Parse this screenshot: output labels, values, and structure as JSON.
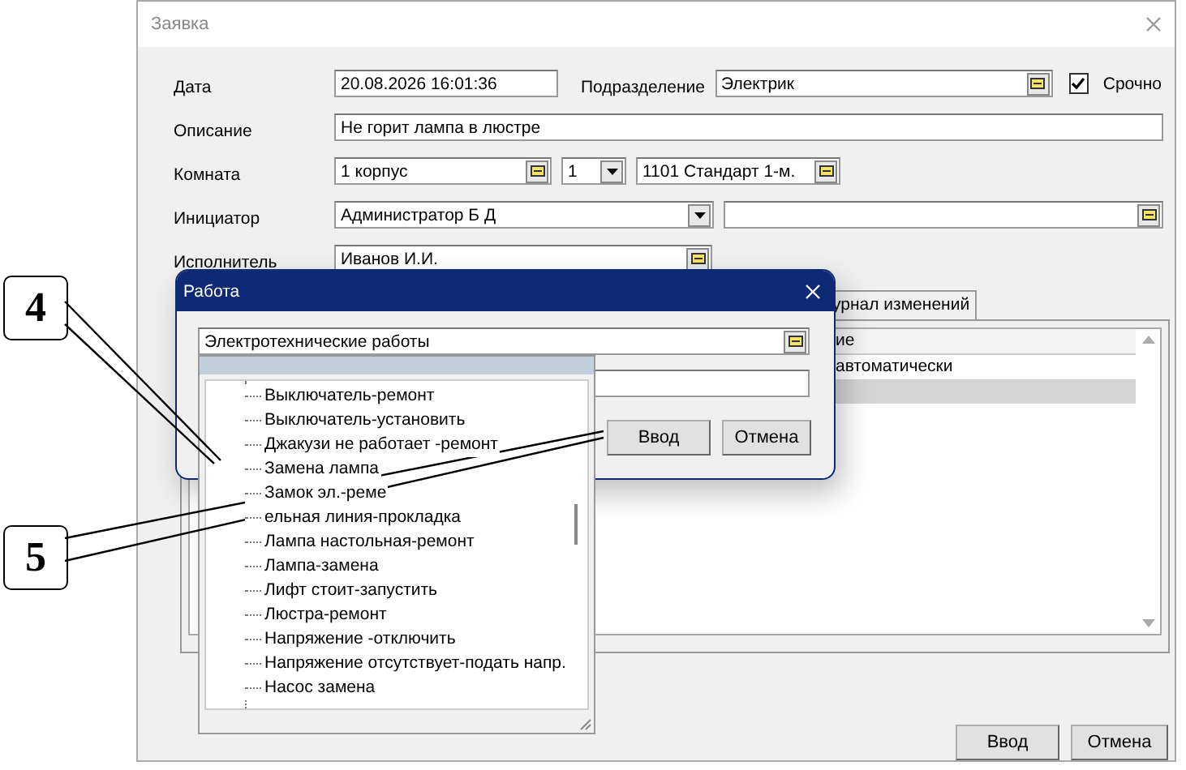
{
  "window": {
    "title": "Заявка"
  },
  "form": {
    "date_label": "Дата",
    "date": "20.08.2026 16:01:36",
    "department_label": "Подразделение",
    "department": "Электрик",
    "urgent": {
      "label": "Срочно",
      "checked": true
    },
    "description_label": "Описание",
    "description": "Не горит лампа в люстре",
    "room_label": "Комната",
    "building": "1 корпус",
    "floor": "1",
    "room": "1101  Стандарт 1-м.",
    "initiator_label": "Инициатор",
    "initiator": "Администратор Б Д",
    "executor_label": "Исполнитель",
    "executor": "Иванов И.И."
  },
  "tabs": [
    {
      "label": "урнал изменений"
    }
  ],
  "table": {
    "columns": [
      "ие"
    ],
    "rows": [
      {
        "text": "автоматически",
        "selected": false
      },
      {
        "selected": true
      }
    ]
  },
  "buttons": [
    "Ввод",
    "Отмена"
  ],
  "dialog": {
    "title": "Работа",
    "work": "Электротехнические работы",
    "buttons": [
      "Ввод",
      "Отмена"
    ]
  },
  "dropdown": {
    "items": [
      "Выключатель-ремонт",
      "Выключатель-установить",
      "Джакузи не работает -ремонт",
      "Замена лампа",
      "Замок эл.-реме",
      "ельная линия-прокладка",
      "Лампа настольная-ремонт",
      "Лампа-замена",
      "Лифт стоит-запустить",
      "Люстра-ремонт",
      "Напряжение -отключить",
      "Напряжение отсутствует-подать напр.",
      "Насос замена"
    ]
  },
  "callouts": [
    {
      "label": "4"
    },
    {
      "label": "5"
    }
  ]
}
